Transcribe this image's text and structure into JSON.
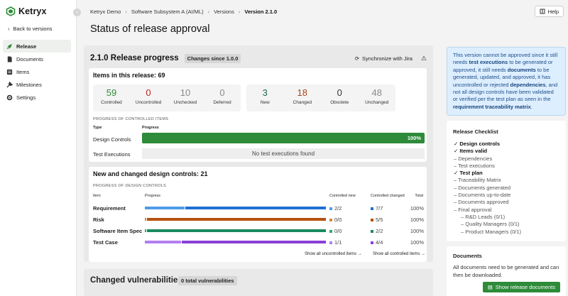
{
  "app": {
    "name": "Ketryx"
  },
  "nav": {
    "back_label": "Back to versions",
    "items": [
      {
        "label": "Release",
        "icon": "rocket-icon",
        "active": true
      },
      {
        "label": "Documents",
        "icon": "document-icon",
        "active": false
      },
      {
        "label": "Items",
        "icon": "list-icon",
        "active": false
      },
      {
        "label": "Milestones",
        "icon": "flag-icon",
        "active": false
      },
      {
        "label": "Settings",
        "icon": "gear-icon",
        "active": false
      }
    ]
  },
  "breadcrumb": [
    "Ketryx Demo",
    "Software Subsystem A (AI/ML)",
    "Versions",
    "Version 2.1.0"
  ],
  "help_label": "Help",
  "page_title": "Status of release approval",
  "release": {
    "title": "2.1.0 Release progress",
    "changes_badge": "Changes since 1.0.0",
    "sync_label": "Synchronize with Jira"
  },
  "items_card": {
    "title": "Items in this release: 69",
    "stats_left": [
      {
        "value": "59",
        "label": "Controlled",
        "color": "#2e8b3a"
      },
      {
        "value": "0",
        "label": "Uncontrolled",
        "color": "#b8231f"
      },
      {
        "value": "10",
        "label": "Unchecked",
        "color": "#8a8a8a"
      },
      {
        "value": "0",
        "label": "Deferred",
        "color": "#8a8a8a"
      }
    ],
    "stats_right": [
      {
        "value": "3",
        "label": "New",
        "color": "#1f6b4a"
      },
      {
        "value": "18",
        "label": "Changed",
        "color": "#a8481c"
      },
      {
        "value": "0",
        "label": "Obsolete",
        "color": "#333333"
      },
      {
        "value": "48",
        "label": "Unchanged",
        "color": "#8a8a8a"
      }
    ],
    "progress_heading": "PROGRESS OF CONTROLLED ITEMS",
    "col_type": "Type",
    "col_progress": "Progress",
    "rows": [
      {
        "type": "Design Controls",
        "progress": "100%"
      },
      {
        "type": "Test Executions",
        "empty": "No test executions found"
      }
    ]
  },
  "design_card": {
    "title": "New and changed design controls: 21",
    "progress_heading": "PROGRESS OF DESIGN CONTROLS",
    "columns": {
      "item": "Item",
      "progress": "Progress",
      "controlled_new": "Controlled new",
      "controlled_changed": "Controlled changed",
      "total": "Total"
    },
    "rows": [
      {
        "name": "Requirement",
        "color": "#1f6fd1",
        "light": "#4f9be8",
        "new_fraction": 0.22,
        "controlled_new": "2/2",
        "controlled_changed": "7/7",
        "total": "100%"
      },
      {
        "name": "Risk",
        "color": "#b5520f",
        "light": "#d9863f",
        "new_fraction": 0.0,
        "controlled_new": "0/0",
        "controlled_changed": "5/5",
        "total": "100%"
      },
      {
        "name": "Software Item Spec",
        "color": "#1a8a5f",
        "light": "#2ea778",
        "new_fraction": 0.0,
        "controlled_new": "0/0",
        "controlled_changed": "2/2",
        "total": "100%"
      },
      {
        "name": "Test Case",
        "color": "#8b3fd8",
        "light": "#b37ef0",
        "new_fraction": 0.2,
        "controlled_new": "1/1",
        "controlled_changed": "4/4",
        "total": "100%"
      }
    ],
    "show_uncontrolled": "Show all uncontrolled items →",
    "show_controlled": "Show all controlled items →"
  },
  "vulnerabilities": {
    "title": "Changed vulnerabilities",
    "badge": "0 total vulnerabilities"
  },
  "info": {
    "p1": "This version cannot be approved since it still needs",
    "b1": "test executions",
    "p2": "to be generated or approved, it still needs",
    "b2": "documents",
    "p3": "to be generated, updated, and approved, it has uncontrolled or rejected",
    "b3": "dependencies",
    "p4": ", and not all design controls have been validated or verified per the test plan as seen in the",
    "b4": "requirement traceability matrix",
    "p5": "."
  },
  "checklist": {
    "title": "Release Checklist",
    "items": [
      {
        "label": "Design controls",
        "done": true,
        "indent": 0
      },
      {
        "label": "Items valid",
        "done": true,
        "indent": 0
      },
      {
        "label": "Dependencies",
        "done": false,
        "indent": 0
      },
      {
        "label": "Test executions",
        "done": false,
        "indent": 0
      },
      {
        "label": "Test plan",
        "done": true,
        "indent": 0
      },
      {
        "label": "Traceability Matrix",
        "done": false,
        "indent": 0
      },
      {
        "label": "Documents generated",
        "done": false,
        "indent": 0
      },
      {
        "label": "Documents up-to-date",
        "done": false,
        "indent": 0
      },
      {
        "label": "Documents approved",
        "done": false,
        "indent": 0
      },
      {
        "label": "Final approval",
        "done": false,
        "indent": 0
      },
      {
        "label": "R&D Leads (0/1)",
        "done": false,
        "indent": 1
      },
      {
        "label": "Quality Managers (0/1)",
        "done": false,
        "indent": 1
      },
      {
        "label": "Product Managers (0/1)",
        "done": false,
        "indent": 1
      }
    ]
  },
  "documents": {
    "title": "Documents",
    "text": "All documents need to be generated and can then be downloaded.",
    "button": "Show release documents"
  }
}
